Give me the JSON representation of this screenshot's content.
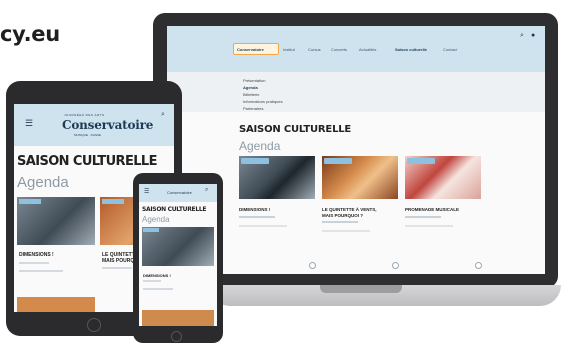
{
  "brand": {
    "domain_text": "cy.eu"
  },
  "laptop": {
    "nav": {
      "items": [
        {
          "label": "Conservatoire",
          "active": true
        },
        {
          "label": "Institut"
        },
        {
          "label": "Cursus"
        },
        {
          "label": "Concerts"
        },
        {
          "label": "Actualités"
        },
        {
          "label": "Saison culturelle",
          "active": true
        },
        {
          "label": "Contact"
        }
      ],
      "search_icon": "search-icon",
      "user_icon": "user-icon"
    },
    "dropdown": {
      "items": [
        "Présentation",
        "Agenda",
        "Billetterie",
        "Informations pratiques",
        "Partenaires"
      ]
    },
    "page_title": "SAISON CULTURELLE",
    "section_title": "Agenda",
    "cards": [
      {
        "tag": "Saison culturelle",
        "title": "DIMENSIONS !",
        "image": "dance"
      },
      {
        "tag": "Saison culturelle",
        "title": "LE QUINTETTE À VENTS,\nMAIS POURQUOI ?",
        "image": "brass"
      },
      {
        "tag": "Saison culturelle",
        "title": "PROMENADE MUSICALE",
        "image": "flower"
      }
    ]
  },
  "tablet": {
    "logo_top": "JOURNÉES DES ARTS",
    "logo": "Conservatoire",
    "logo_sub": "MUSIQUE · DANSE",
    "page_title": "SAISON CULTURELLE",
    "section_title": "Agenda",
    "cards": [
      {
        "title": "DIMENSIONS !"
      },
      {
        "title": "LE QUINTETTE À VENTS,\nMAIS POURQUOI ?"
      }
    ]
  },
  "phone": {
    "logo": "Conservatoire",
    "page_title": "SAISON CULTURELLE",
    "section_title": "Agenda",
    "card_title": "DIMENSIONS !"
  },
  "colors": {
    "nav_bg": "#cfe3ef",
    "tag": "#8ec0e0",
    "device": "#2e2e30",
    "accent": "#1d3b56"
  }
}
